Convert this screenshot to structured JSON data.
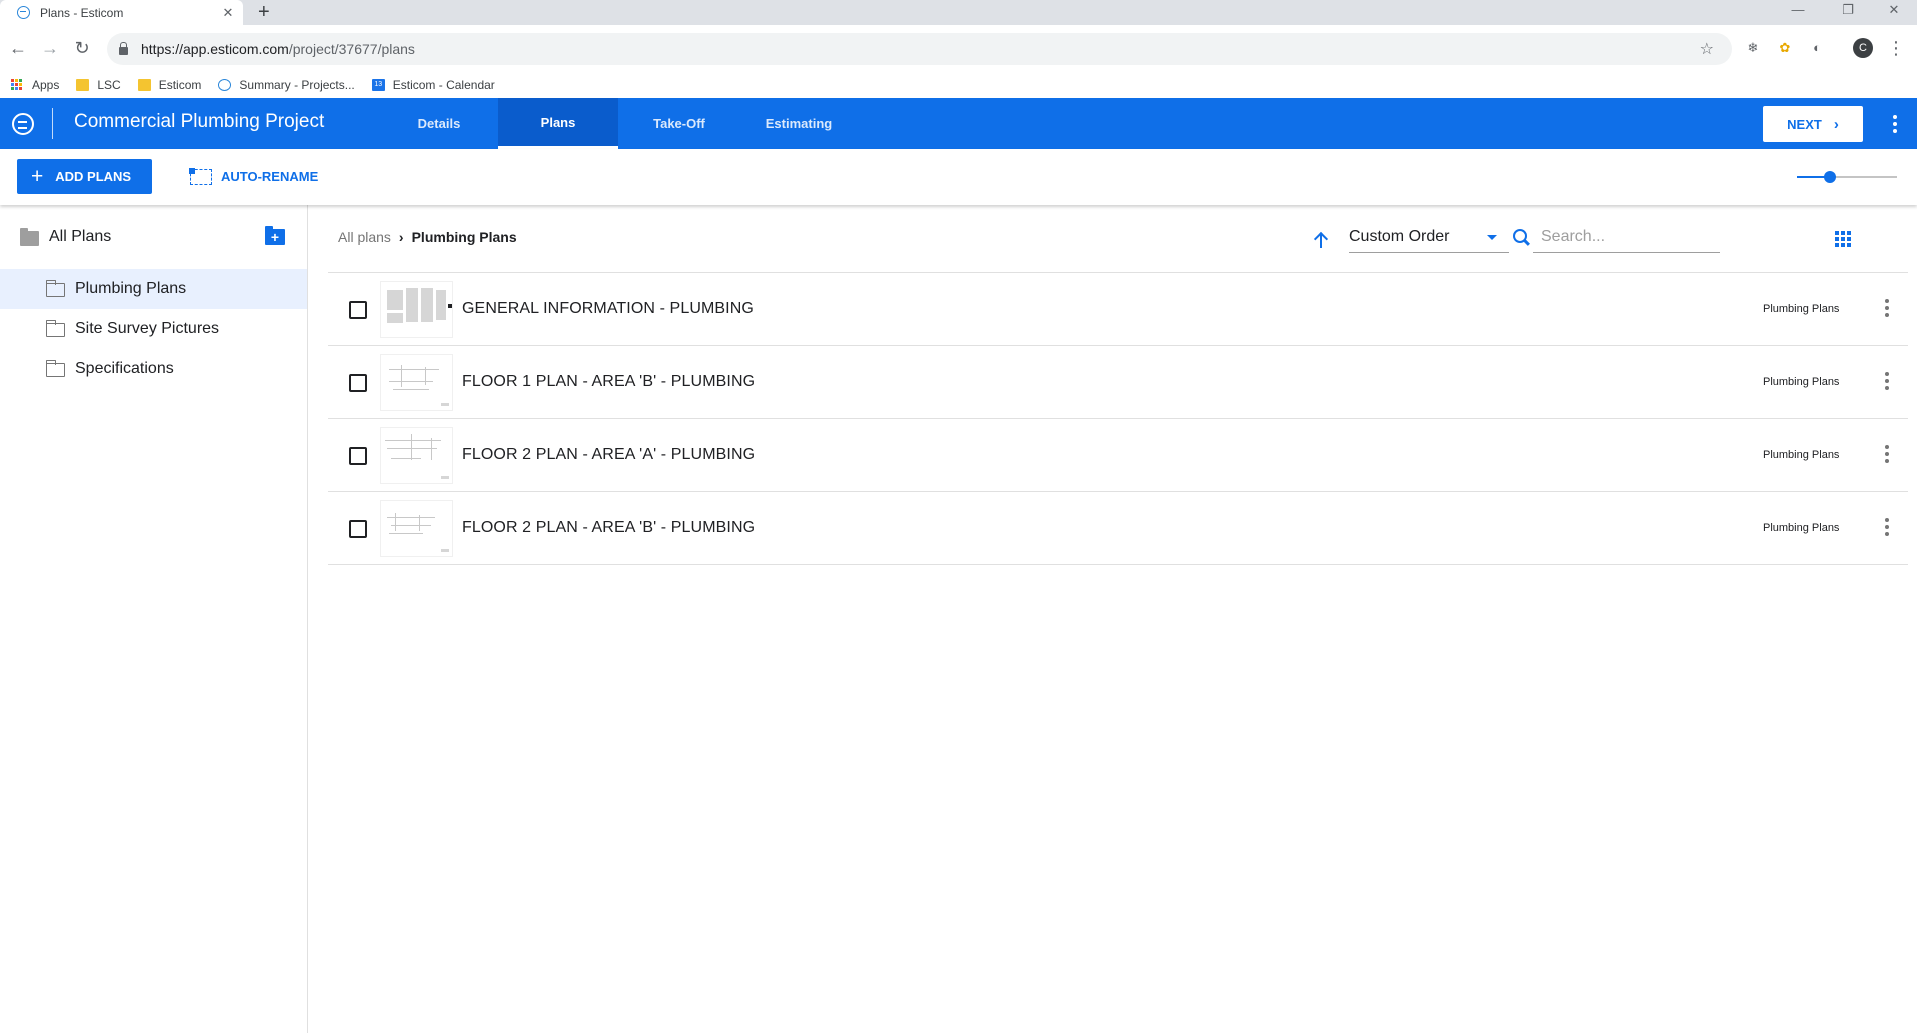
{
  "browser": {
    "tab_title": "Plans - Esticom",
    "tab_close": "✕",
    "new_tab": "+",
    "url_host": "https://app.esticom.com",
    "url_path": "/project/37677/plans",
    "profile_initial": "C",
    "bookmarks": [
      {
        "label": "Apps",
        "icon": "apps-grid-icon"
      },
      {
        "label": "LSC",
        "icon": "folder-icon"
      },
      {
        "label": "Esticom",
        "icon": "folder-icon"
      },
      {
        "label": "Summary - Projects...",
        "icon": "esticom-logo-icon"
      },
      {
        "label": "Esticom - Calendar",
        "icon": "calendar-icon",
        "icon_text": "13"
      }
    ]
  },
  "app": {
    "project_title": "Commercial Plumbing Project",
    "tabs": [
      {
        "label": "Details",
        "active": false
      },
      {
        "label": "Plans",
        "active": true
      },
      {
        "label": "Take-Off",
        "active": false
      },
      {
        "label": "Estimating",
        "active": false
      }
    ],
    "next_label": "NEXT",
    "brand_color": "#0f6fe8"
  },
  "actions": {
    "add_plans_label": "ADD PLANS",
    "auto_rename_label": "AUTO-RENAME",
    "thumbnail_zoom": 0.27
  },
  "sidebar": {
    "root_label": "All Plans",
    "folders": [
      {
        "label": "Plumbing Plans",
        "selected": true
      },
      {
        "label": "Site Survey Pictures",
        "selected": false
      },
      {
        "label": "Specifications",
        "selected": false
      }
    ]
  },
  "main": {
    "breadcrumb_root": "All plans",
    "breadcrumb_current": "Plumbing Plans",
    "sort_value": "Custom Order",
    "search_placeholder": "Search...",
    "plans": [
      {
        "name": "GENERAL INFORMATION - PLUMBING",
        "folder": "Plumbing Plans",
        "checked": false
      },
      {
        "name": "FLOOR 1 PLAN - AREA 'B' - PLUMBING",
        "folder": "Plumbing Plans",
        "checked": false
      },
      {
        "name": "FLOOR 2 PLAN - AREA 'A' - PLUMBING",
        "folder": "Plumbing Plans",
        "checked": false
      },
      {
        "name": "FLOOR 2 PLAN - AREA 'B' - PLUMBING",
        "folder": "Plumbing Plans",
        "checked": false
      }
    ]
  }
}
